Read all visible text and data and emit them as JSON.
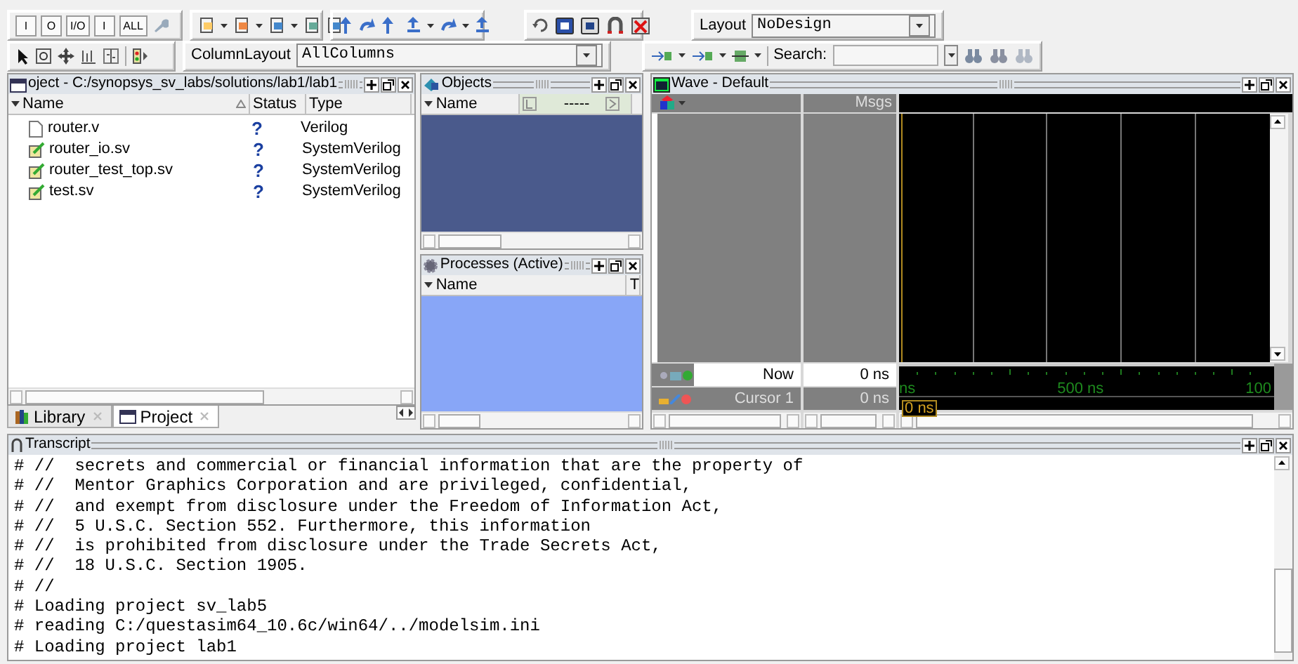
{
  "toolbar": {
    "io_buttons": [
      "I",
      "O",
      "I/O",
      "I",
      "ALL"
    ],
    "layout_label": "Layout",
    "layout_value": "NoDesign",
    "column_layout_label": "ColumnLayout",
    "column_layout_value": "AllColumns",
    "search_label": "Search:"
  },
  "project_pane": {
    "title": "oject - C:/synopsys_sv_labs/solutions/lab1/lab1",
    "columns": [
      "Name",
      "Status",
      "Type"
    ],
    "files": [
      {
        "name": "router.v",
        "status": "?",
        "type": "Verilog",
        "kind": "plain"
      },
      {
        "name": "router_io.sv",
        "status": "?",
        "type": "SystemVerilog",
        "kind": "edited"
      },
      {
        "name": "router_test_top.sv",
        "status": "?",
        "type": "SystemVerilog",
        "kind": "edited"
      },
      {
        "name": "test.sv",
        "status": "?",
        "type": "SystemVerilog",
        "kind": "edited"
      }
    ],
    "tabs": [
      {
        "label": "Library",
        "selected": false
      },
      {
        "label": "Project",
        "selected": true
      }
    ]
  },
  "objects_pane": {
    "title": "Objects",
    "columns": [
      "Name",
      "-----"
    ]
  },
  "processes_pane": {
    "title": "Processes (Active)",
    "columns": [
      "Name",
      "T"
    ]
  },
  "wave_pane": {
    "title": "Wave - Default",
    "msgs_header": "Msgs",
    "now_label": "Now",
    "now_value": "0 ns",
    "cursor_label": "Cursor 1",
    "cursor_value": "0 ns",
    "timeline_labels": [
      "ns",
      "500 ns",
      "100"
    ],
    "cursor_time": "0 ns"
  },
  "transcript": {
    "title": "Transcript",
    "lines": [
      "# //  secrets and commercial or financial information that are the property of",
      "# //  Mentor Graphics Corporation and are privileged, confidential,",
      "# //  and exempt from disclosure under the Freedom of Information Act,",
      "# //  5 U.S.C. Section 552. Furthermore, this information",
      "# //  is prohibited from disclosure under the Trade Secrets Act,",
      "# //  18 U.S.C. Section 1905.",
      "# //",
      "# Loading project sv_lab5",
      "# reading C:/questasim64_10.6c/win64/../modelsim.ini",
      "# Loading project lab1"
    ]
  }
}
